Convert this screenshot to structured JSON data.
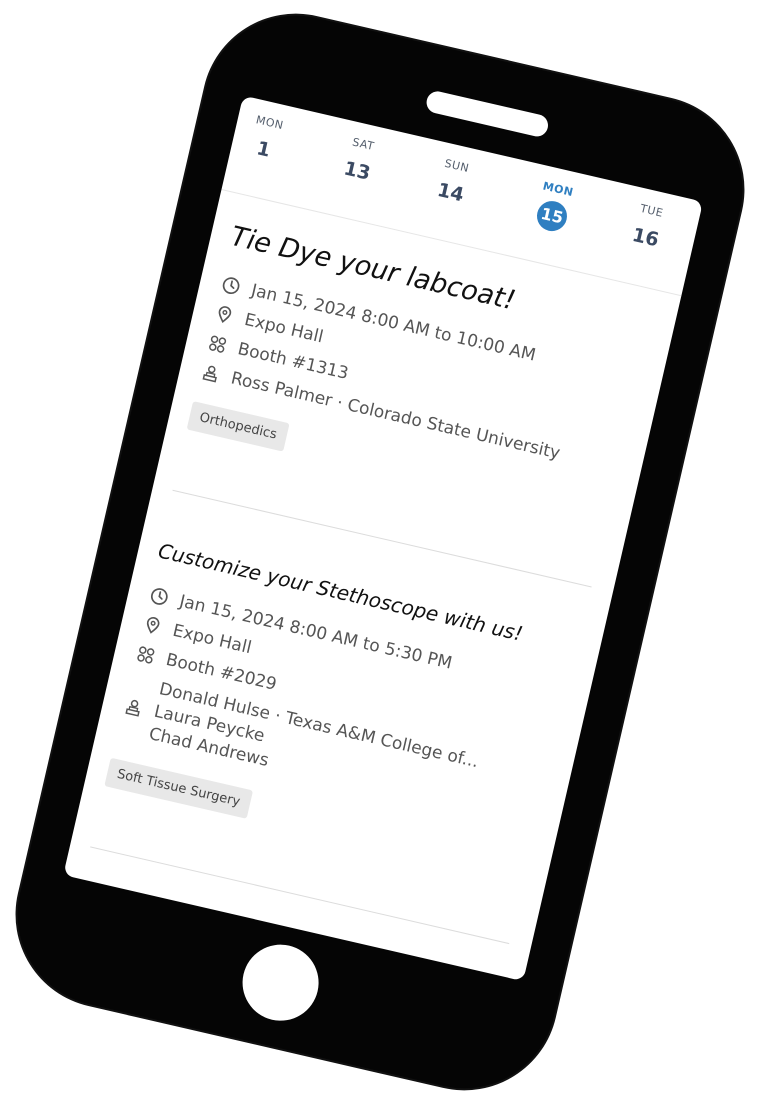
{
  "calendar": {
    "days": [
      {
        "dow": "MON",
        "num": "1"
      },
      {
        "dow": "SAT",
        "num": "13"
      },
      {
        "dow": "SUN",
        "num": "14"
      },
      {
        "dow": "MON",
        "num": "15",
        "active": true
      },
      {
        "dow": "TUE",
        "num": "16"
      }
    ]
  },
  "events": [
    {
      "title": "Tie Dye your labcoat!",
      "time": "Jan 15, 2024 8:00 AM to 10:00 AM",
      "location": "Expo Hall",
      "booth": "Booth #1313",
      "people": [
        "Ross Palmer · Colorado State University"
      ],
      "tag": "Orthopedics"
    },
    {
      "title": "Customize your Stethoscope with us!",
      "time": "Jan 15, 2024 8:00 AM to 5:30 PM",
      "location": "Expo Hall",
      "booth": "Booth #2029",
      "people": [
        "Donald Hulse · Texas A&M College of...",
        "Laura Peycke",
        "Chad Andrews"
      ],
      "tag": "Soft Tissue Surgery"
    }
  ],
  "colors": {
    "accent": "#2f7fc1",
    "phone_body": "#050505",
    "chip_bg": "#e8e8e8"
  },
  "icons": {
    "time": "clock-icon",
    "location": "location-pin-icon",
    "booth": "booth-grid-icon",
    "people": "presenter-icon"
  }
}
